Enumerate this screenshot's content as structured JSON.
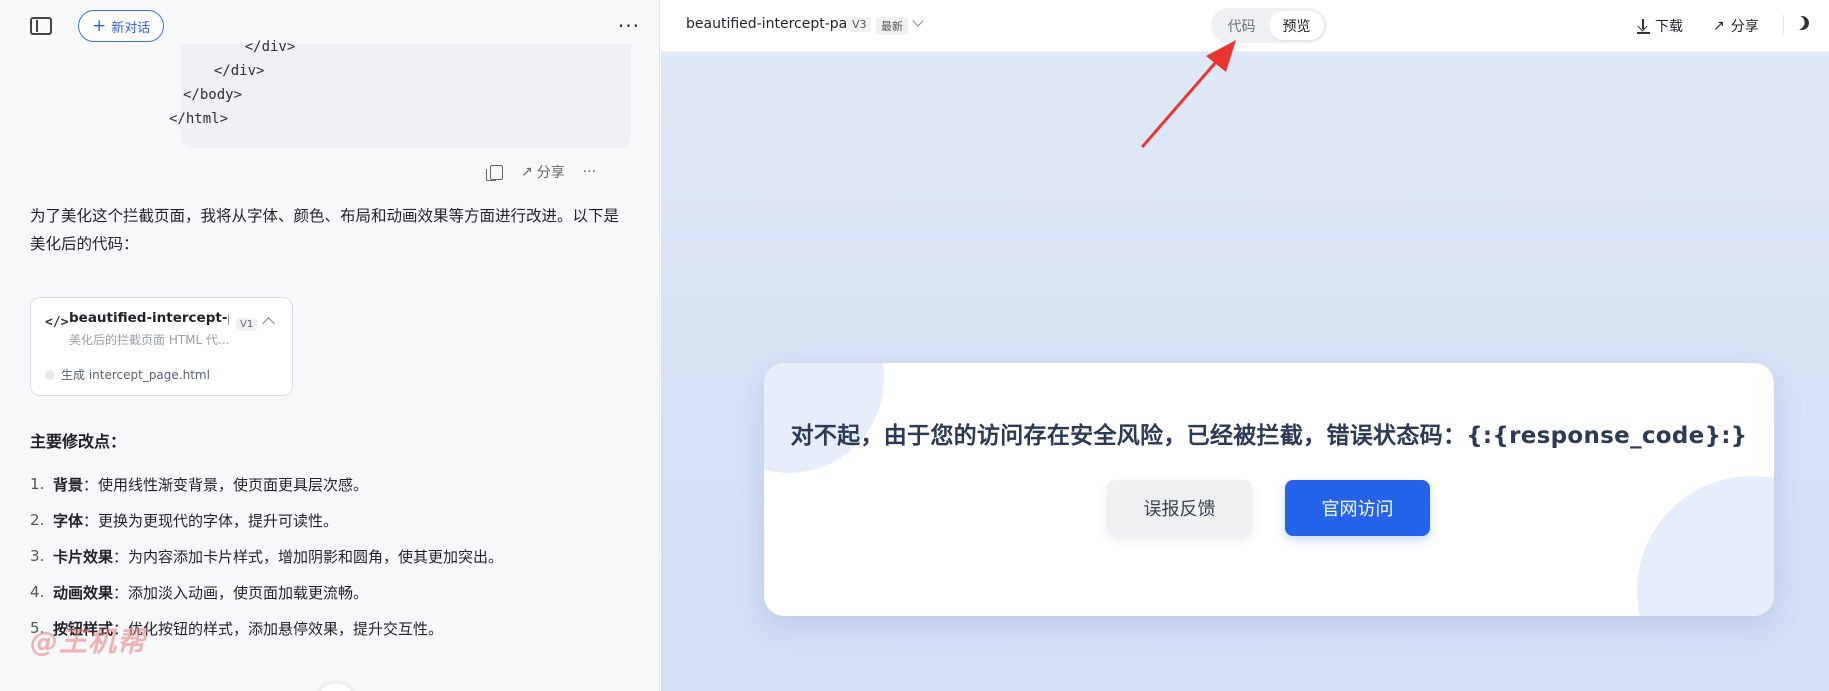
{
  "left_panel": {
    "new_chat_label": "新对话",
    "code_lines": [
      "    </div>",
      "  </div>",
      "</body>",
      "</html>"
    ],
    "share_label": "分享",
    "reply_text": "为了美化这个拦截页面，我将从字体、颜色、布局和动画效果等方面进行改进。以下是美化后的代码：",
    "artifact": {
      "title": "beautified-intercept-p...",
      "subtitle": "美化后的拦截页面 HTML 代...",
      "version": "V1",
      "status": "生成 intercept_page.html"
    },
    "list_title": "主要修改点：",
    "modifications": [
      {
        "num": "1.",
        "term": "背景",
        "desc": "：使用线性渐变背景，使页面更具层次感。"
      },
      {
        "num": "2.",
        "term": "字体",
        "desc": "：更换为更现代的字体，提升可读性。"
      },
      {
        "num": "3.",
        "term": "卡片效果",
        "desc": "：为内容添加卡片样式，增加阴影和圆角，使其更加突出。"
      },
      {
        "num": "4.",
        "term": "动画效果",
        "desc": "：添加淡入动画，使页面加载更流畅。"
      },
      {
        "num": "5.",
        "term": "按钮样式",
        "desc": "：优化按钮的样式，添加悬停效果，提升交互性。"
      }
    ],
    "watermark": "@王机帮"
  },
  "right_panel": {
    "doc_title": "beautified-intercept-page",
    "version": "V3",
    "newest": "最新",
    "tabs": [
      {
        "label": "代码",
        "active": false
      },
      {
        "label": "预览",
        "active": true
      }
    ],
    "download_label": "下载",
    "share_label": "分享",
    "preview": {
      "message": "对不起，由于您的访问存在安全风险，已经被拦截，错误状态码：{:{response_code}:}",
      "feedback_button": "误报反馈",
      "official_button": "官网访问"
    }
  },
  "colors": {
    "accent": "#2563eb",
    "annotation_arrow": "#e8362f",
    "preview_bg": "#d9e4f6"
  }
}
